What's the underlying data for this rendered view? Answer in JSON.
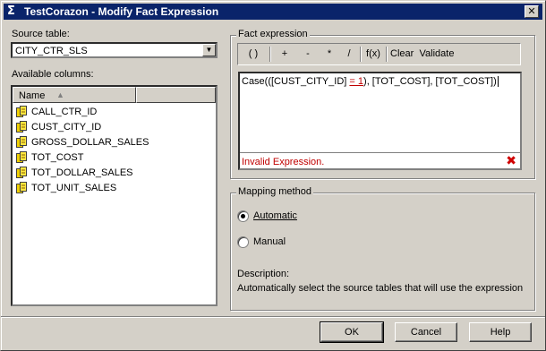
{
  "window": {
    "title": "TestCorazon - Modify Fact Expression",
    "icon": "sigma-icon"
  },
  "left": {
    "source_table_label": "Source table:",
    "source_table_value": "CITY_CTR_SLS",
    "available_columns_label": "Available columns:",
    "column_header": "Name",
    "columns": [
      "CALL_CTR_ID",
      "CUST_CITY_ID",
      "GROSS_DOLLAR_SALES",
      "TOT_COST",
      "TOT_DOLLAR_SALES",
      "TOT_UNIT_SALES"
    ]
  },
  "fact_expression": {
    "group_label": "Fact expression",
    "toolbar": {
      "parens": "( )",
      "plus": "+",
      "minus": "-",
      "multiply": "*",
      "divide": "/",
      "function": "f(x)",
      "clear": "Clear",
      "validate": "Validate"
    },
    "expression_pre": "Case(([CUST_CITY_ID] ",
    "expression_error": "= 1",
    "expression_post": "), [TOT_COST], [TOT_COST])",
    "status": "Invalid Expression.",
    "status_color": "#c00000"
  },
  "mapping": {
    "group_label": "Mapping method",
    "automatic": "Automatic",
    "manual": "Manual",
    "selected": "Automatic",
    "description_label": "Description:",
    "description_text": "Automatically select the source tables that will use the expression"
  },
  "buttons": {
    "ok": "OK",
    "cancel": "Cancel",
    "help": "Help"
  }
}
